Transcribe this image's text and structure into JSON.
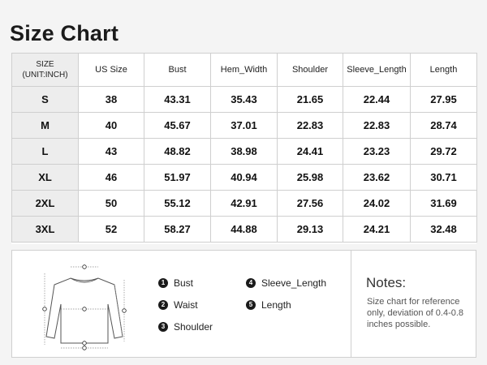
{
  "title": "Size Chart",
  "table": {
    "headers": [
      "SIZE\n(UNIT:INCH)",
      "US Size",
      "Bust",
      "Hem_Width",
      "Shoulder",
      "Sleeve_Length",
      "Length"
    ],
    "rows": [
      [
        "S",
        "38",
        "43.31",
        "35.43",
        "21.65",
        "22.44",
        "27.95"
      ],
      [
        "M",
        "40",
        "45.67",
        "37.01",
        "22.83",
        "22.83",
        "28.74"
      ],
      [
        "L",
        "43",
        "48.82",
        "38.98",
        "24.41",
        "23.23",
        "29.72"
      ],
      [
        "XL",
        "46",
        "51.97",
        "40.94",
        "25.98",
        "23.62",
        "30.71"
      ],
      [
        "2XL",
        "50",
        "55.12",
        "42.91",
        "27.56",
        "24.02",
        "31.69"
      ],
      [
        "3XL",
        "52",
        "58.27",
        "44.88",
        "29.13",
        "24.21",
        "32.48"
      ]
    ]
  },
  "legend": [
    {
      "num": "1",
      "label": "Bust"
    },
    {
      "num": "2",
      "label": "Waist"
    },
    {
      "num": "3",
      "label": "Shoulder"
    },
    {
      "num": "4",
      "label": "Sleeve_Length"
    },
    {
      "num": "5",
      "label": "Length"
    }
  ],
  "notes": {
    "title": "Notes:",
    "text": "Size chart for reference only, deviation of 0.4-0.8 inches possible."
  }
}
